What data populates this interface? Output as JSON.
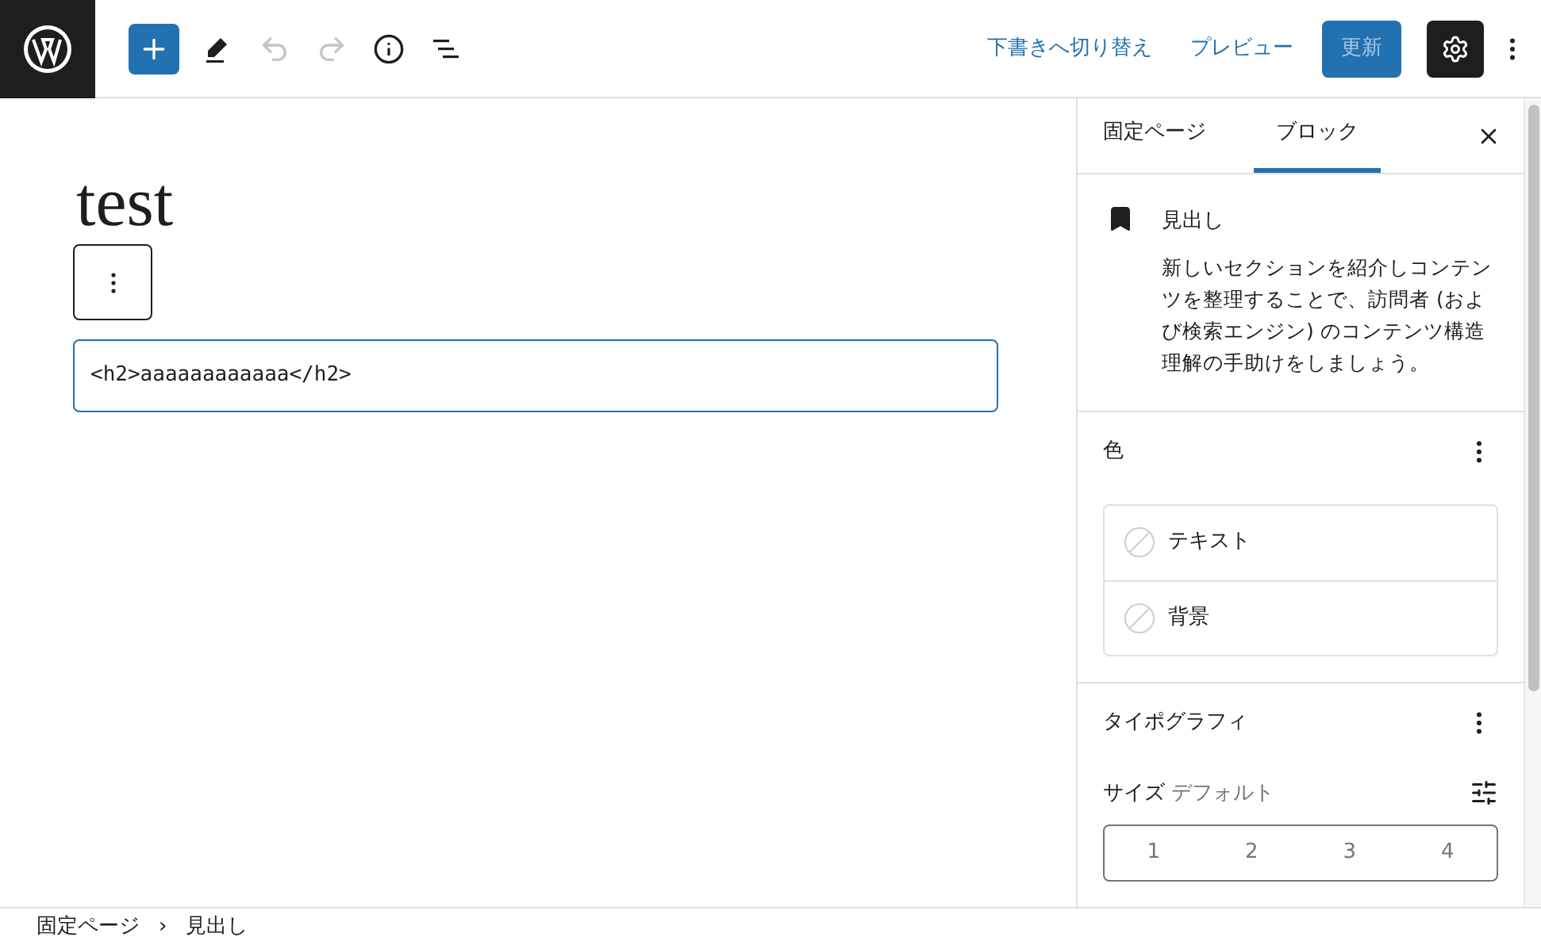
{
  "toolbar": {
    "buttons": [
      {
        "kind": "add"
      },
      {
        "kind": "pen"
      },
      {
        "kind": "undo",
        "disabled": true
      },
      {
        "kind": "redo",
        "disabled": true
      },
      {
        "kind": "info"
      },
      {
        "kind": "list"
      }
    ],
    "draft_link": "下書きへ切り替え",
    "preview_link": "プレビュー",
    "update_button": "更新",
    "settings_on": true
  },
  "editor": {
    "title": "test",
    "block_html": "<h2>aaaaaaaaaaaa</h2>"
  },
  "sidebar": {
    "tabs": [
      {
        "label": "固定ページ",
        "selected": false
      },
      {
        "label": "ブロック",
        "selected": true
      }
    ],
    "block": {
      "name": "見出し",
      "description": "新しいセクションを紹介しコンテンツを整理することで、訪問者 (および検索エンジン) のコンテンツ構造理解の手助けをしましょう。"
    },
    "color": {
      "title": "色",
      "items": [
        {
          "label": "テキスト"
        },
        {
          "label": "背景"
        }
      ]
    },
    "typography": {
      "title": "タイポグラフィ",
      "size_label": "サイズ",
      "size_value": "デフォルト",
      "sizes": [
        "1",
        "2",
        "3",
        "4"
      ]
    }
  },
  "breadcrumb": [
    "固定ページ",
    "見出し"
  ],
  "breadcrumb_separator": "›"
}
